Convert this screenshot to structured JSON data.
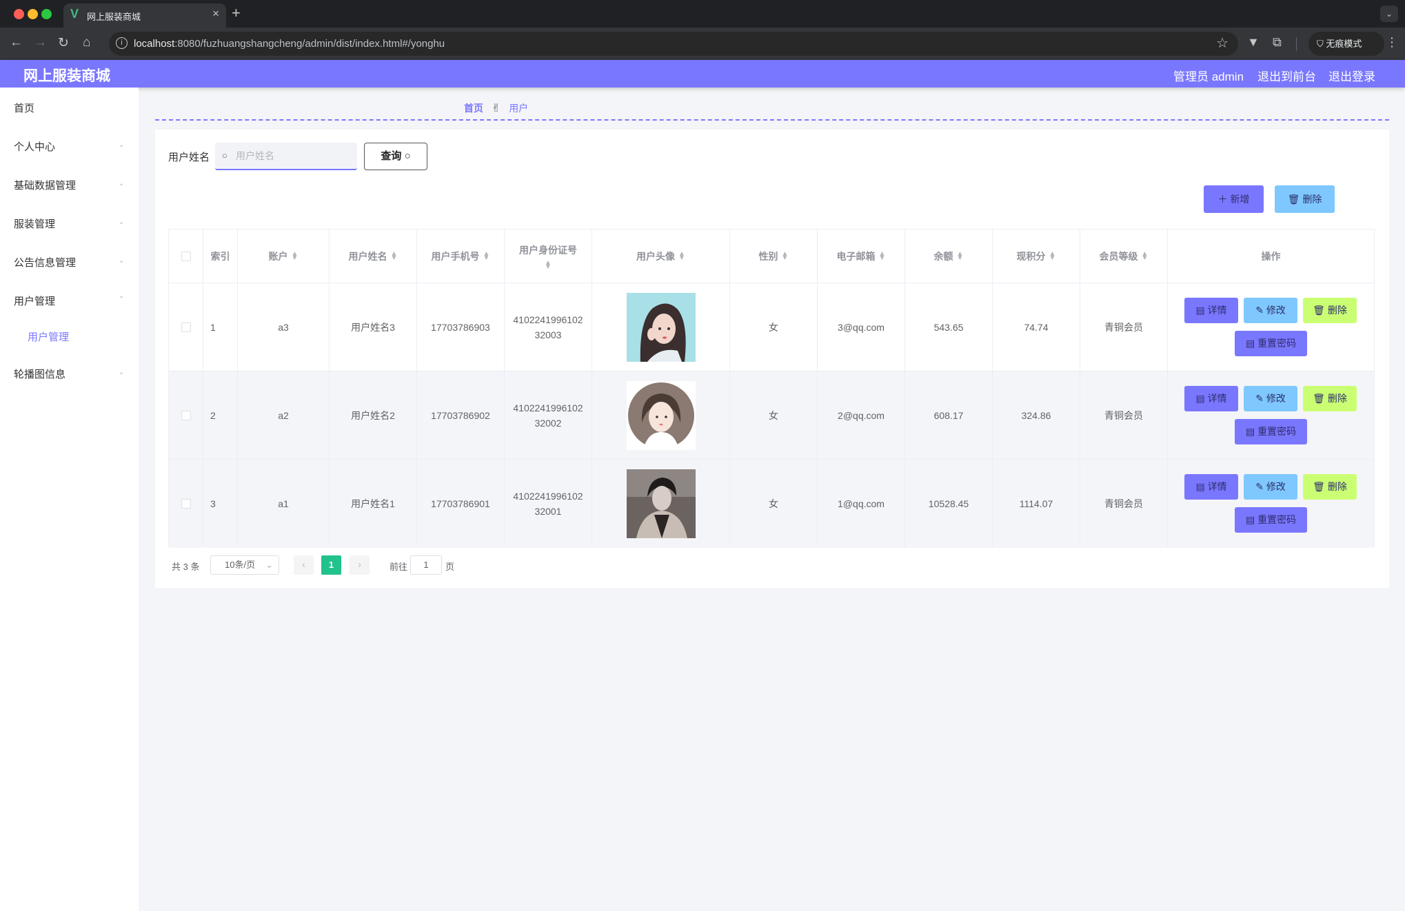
{
  "browser": {
    "tab_title": "网上服装商城",
    "url_host": "localhost",
    "url_rest": ":8080/fuzhuangshangcheng/admin/dist/index.html#/yonghu",
    "incognito_label": "无痕模式"
  },
  "header": {
    "brand": "网上服装商城",
    "admin_label": "管理员 admin",
    "to_front": "退出到前台",
    "logout": "退出登录"
  },
  "sidebar": {
    "items": [
      {
        "label": "首页"
      },
      {
        "label": "个人中心"
      },
      {
        "label": "基础数据管理"
      },
      {
        "label": "服装管理"
      },
      {
        "label": "公告信息管理"
      },
      {
        "label": "用户管理"
      },
      {
        "label": "用户管理"
      },
      {
        "label": "轮播图信息"
      }
    ]
  },
  "breadcrumb": {
    "home": "首页",
    "current": "用户"
  },
  "search": {
    "label": "用户姓名",
    "placeholder": "用户姓名",
    "button": "查询"
  },
  "actions": {
    "add": "新增",
    "delete": "删除"
  },
  "table": {
    "headers": [
      "索引",
      "账户",
      "用户姓名",
      "用户手机号",
      "用户身份证号",
      "用户头像",
      "性别",
      "电子邮箱",
      "余额",
      "现积分",
      "会员等级",
      "操作"
    ],
    "rows": [
      {
        "index": "1",
        "account": "a3",
        "name": "用户姓名3",
        "phone": "17703786903",
        "id_l1": "4102241996102",
        "id_l2": "32003",
        "gender": "女",
        "email": "3@qq.com",
        "balance": "543.65",
        "points": "74.74",
        "level": "青铜会员"
      },
      {
        "index": "2",
        "account": "a2",
        "name": "用户姓名2",
        "phone": "17703786902",
        "id_l1": "4102241996102",
        "id_l2": "32002",
        "gender": "女",
        "email": "2@qq.com",
        "balance": "608.17",
        "points": "324.86",
        "level": "青铜会员"
      },
      {
        "index": "3",
        "account": "a1",
        "name": "用户姓名1",
        "phone": "17703786901",
        "id_l1": "4102241996102",
        "id_l2": "32001",
        "gender": "女",
        "email": "1@qq.com",
        "balance": "10528.45",
        "points": "1114.07",
        "level": "青铜会员"
      }
    ],
    "row_buttons": {
      "detail": "详情",
      "edit": "修改",
      "delete": "删除",
      "reset": "重置密码"
    }
  },
  "pagination": {
    "total": "共 3 条",
    "page_size": "10条/页",
    "current": "1",
    "goto_prefix": "前往",
    "goto_value": "1",
    "goto_suffix": "页"
  },
  "colors": {
    "accent": "#7a77ff",
    "edit": "#7fc8ff",
    "delete": "#cbff73",
    "active_page": "#21c28b"
  }
}
